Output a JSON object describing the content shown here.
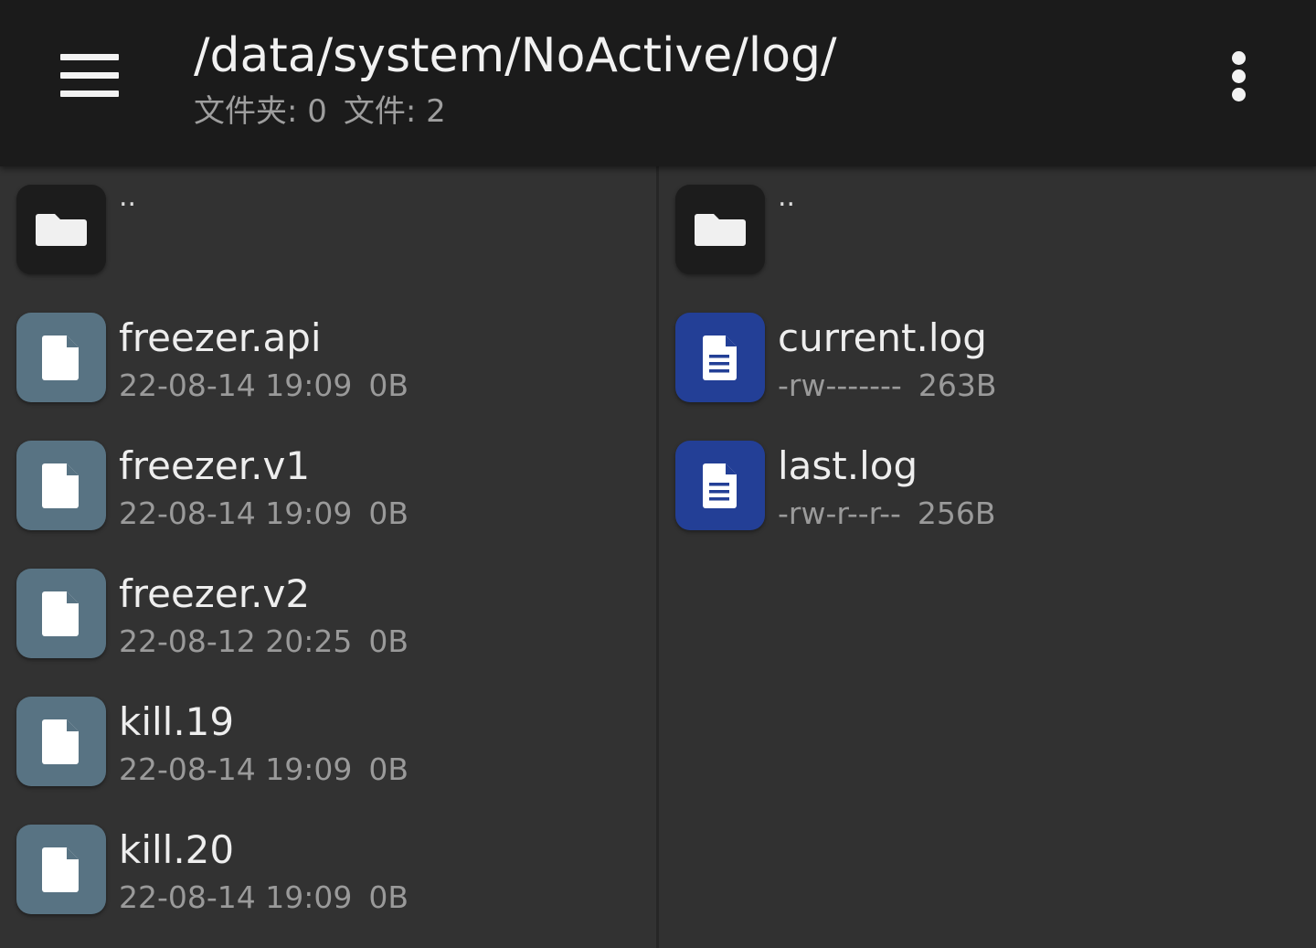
{
  "header": {
    "path": "/data/system/NoActive/log/",
    "folders_label": "文件夹: 0",
    "files_label": "文件: 2",
    "menu_icon": "hamburger-menu-icon",
    "more_icon": "more-vert-icon"
  },
  "left_pane": {
    "parent": {
      "name": "..",
      "icon": "folder-icon"
    },
    "files": [
      {
        "name": "freezer.api",
        "date": "22-08-14 19:09",
        "size": "0B",
        "icon": "file-icon"
      },
      {
        "name": "freezer.v1",
        "date": "22-08-14 19:09",
        "size": "0B",
        "icon": "file-icon"
      },
      {
        "name": "freezer.v2",
        "date": "22-08-12 20:25",
        "size": "0B",
        "icon": "file-icon"
      },
      {
        "name": "kill.19",
        "date": "22-08-14 19:09",
        "size": "0B",
        "icon": "file-icon"
      },
      {
        "name": "kill.20",
        "date": "22-08-14 19:09",
        "size": "0B",
        "icon": "file-icon"
      }
    ]
  },
  "right_pane": {
    "parent": {
      "name": "..",
      "icon": "folder-icon"
    },
    "files": [
      {
        "name": "current.log",
        "perms": "-rw-------",
        "size": "263B",
        "icon": "text-document-icon"
      },
      {
        "name": "last.log",
        "perms": "-rw-r--r--",
        "size": "256B",
        "icon": "text-document-icon"
      }
    ]
  },
  "colors": {
    "appbar": "#1b1b1b",
    "pane_bg": "#323232",
    "file_tile": "#587383",
    "log_tile": "#233f96",
    "folder_tile": "#1c1c1c"
  }
}
